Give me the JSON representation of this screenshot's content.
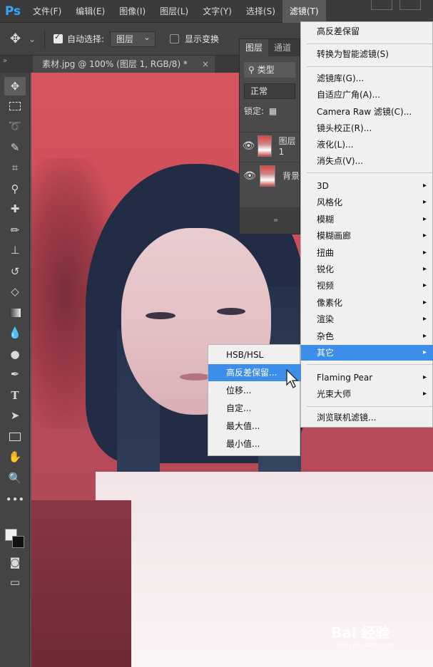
{
  "app": {
    "logo": "Ps"
  },
  "menubar": {
    "items": [
      "文件(F)",
      "编辑(E)",
      "图像(I)",
      "图层(L)",
      "文字(Y)",
      "选择(S)",
      "滤镜(T)"
    ]
  },
  "options": {
    "auto_select_label": "自动选择:",
    "auto_select_checked": true,
    "target_value": "图层",
    "show_transform_label": "显示变换"
  },
  "document": {
    "tab_title": "素材.jpg @ 100% (图层 1, RGB/8) *",
    "close": "×"
  },
  "layers_panel": {
    "tabs": [
      "图层",
      "通道"
    ],
    "search_label": "类型",
    "blend_mode": "正常",
    "lock_label": "锁定:",
    "layers": [
      {
        "name": "图层 1",
        "visible": true
      },
      {
        "name": "背景",
        "visible": true
      }
    ]
  },
  "filter_menu": {
    "last_filter": "高反差保留",
    "convert_smart": "转换为智能滤镜(S)",
    "group1": [
      "滤镜库(G)...",
      "自适应广角(A)...",
      "Camera Raw 滤镜(C)...",
      "镜头校正(R)...",
      "液化(L)...",
      "消失点(V)..."
    ],
    "group2": [
      "3D",
      "风格化",
      "模糊",
      "模糊画廊",
      "扭曲",
      "锐化",
      "视频",
      "像素化",
      "渲染",
      "杂色",
      "其它"
    ],
    "group3": [
      "Flaming Pear",
      "光束大师"
    ],
    "browse": "浏览联机滤镜...",
    "highlighted": "其它"
  },
  "submenu": {
    "items": [
      "HSB/HSL",
      "高反差保留...",
      "位移...",
      "自定...",
      "最大值...",
      "最小值..."
    ],
    "highlighted": "高反差保留..."
  },
  "watermark": {
    "main": "Bai 经验",
    "sub": "jingyan.baidu.com"
  },
  "colors": {
    "accent": "#3d8ee8",
    "ps_blue": "#31a8ff"
  }
}
